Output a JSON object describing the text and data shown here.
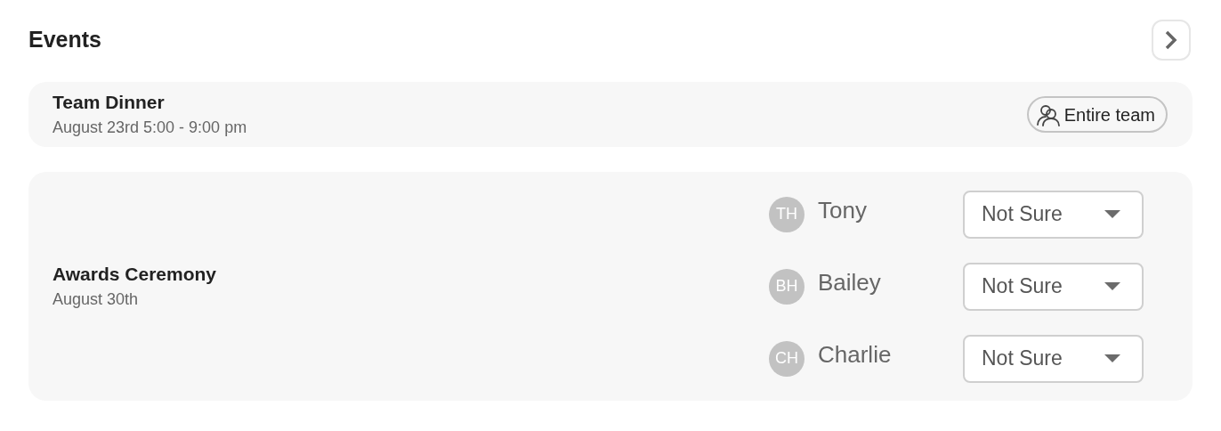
{
  "title": "Events",
  "events": [
    {
      "kind": "team",
      "name": "Team Dinner",
      "date": "August 23rd 5:00 - 9:00 pm",
      "audience": "Entire team"
    },
    {
      "kind": "attendees",
      "name": "Awards Ceremony",
      "date": "August 30th",
      "attendees": [
        {
          "initials": "TH",
          "name": "Tony",
          "response": "Not Sure"
        },
        {
          "initials": "BH",
          "name": "Bailey",
          "response": "Not Sure"
        },
        {
          "initials": "CH",
          "name": "Charlie",
          "response": "Not Sure"
        }
      ]
    }
  ]
}
